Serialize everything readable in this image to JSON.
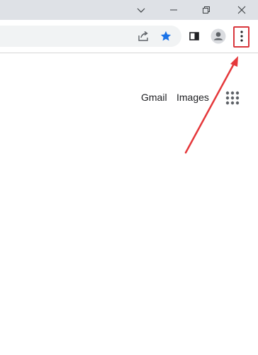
{
  "window_controls": {
    "tab_search_icon": "chevron-down-icon",
    "minimize_icon": "minimize-icon",
    "restore_icon": "restore-icon",
    "close_icon": "close-icon"
  },
  "toolbar": {
    "share_icon": "share-icon",
    "bookmark_icon": "star-icon",
    "side_panel_icon": "side-panel-icon",
    "profile_icon": "avatar-icon",
    "menu_icon": "kebab-menu-icon"
  },
  "page": {
    "gmail_label": "Gmail",
    "images_label": "Images",
    "apps_icon": "apps-grid-icon"
  },
  "annotation": {
    "color": "#e5383b",
    "target": "menu-button"
  },
  "colors": {
    "titlebar_bg": "#dee1e6",
    "omnibox_bg": "#f1f3f4",
    "star_blue": "#1a73e8",
    "icon_gray": "#5f6368"
  }
}
